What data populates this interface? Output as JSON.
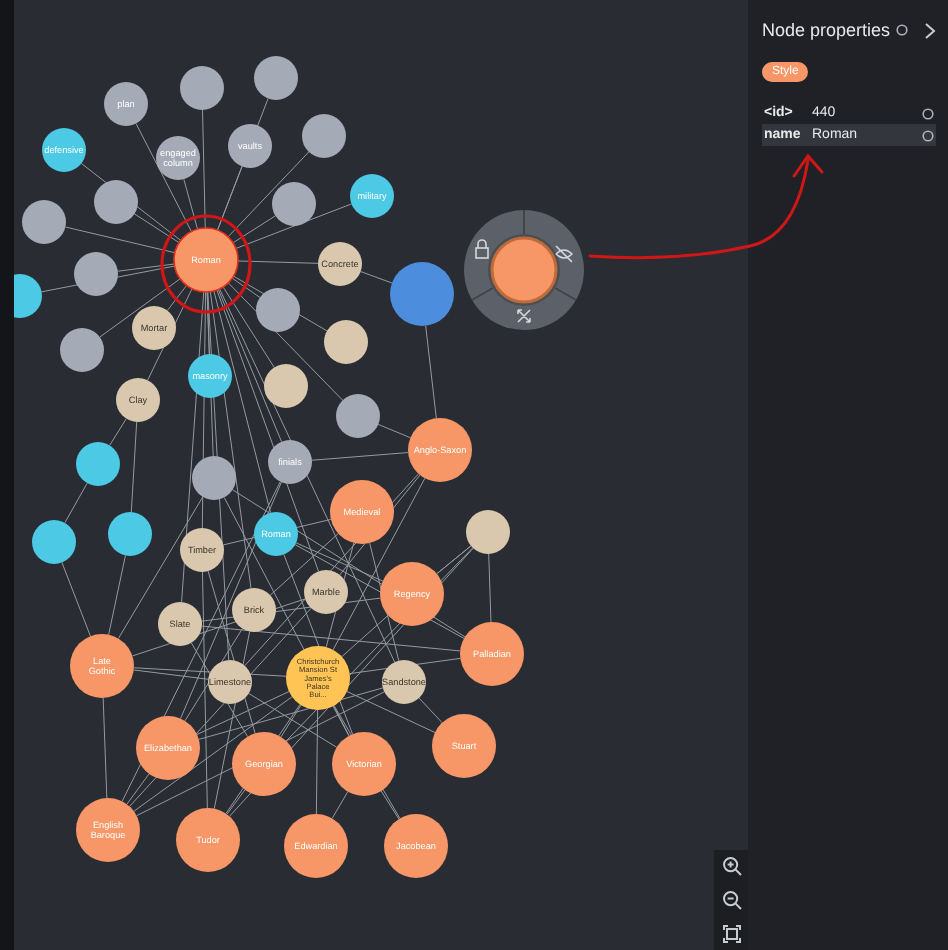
{
  "graph": {
    "nodes": [
      {
        "label": "Roman",
        "color": "#f79767",
        "kind": "big",
        "circled": true,
        "selected": false
      },
      {
        "label": "plan",
        "color": "#a5abb6",
        "kind": "small",
        "circled": false,
        "selected": false
      },
      {
        "color": "#a5abb6",
        "kind": "small",
        "circled": false,
        "selected": false
      },
      {
        "color": "#a5abb6",
        "kind": "small",
        "circled": false,
        "selected": false
      },
      {
        "label": "defensive",
        "color": "#4cc9e4",
        "kind": "small",
        "circled": false,
        "selected": false
      },
      {
        "label": "engaged column",
        "color": "#a5abb6",
        "kind": "small",
        "circled": false,
        "selected": false
      },
      {
        "label": "vaults",
        "color": "#a5abb6",
        "kind": "small",
        "circled": false,
        "selected": false
      },
      {
        "color": "#a5abb6",
        "kind": "small",
        "circled": false,
        "selected": false
      },
      {
        "color": "#a5abb6",
        "kind": "small",
        "circled": false,
        "selected": false
      },
      {
        "color": "#a5abb6",
        "kind": "small",
        "circled": false,
        "selected": false
      },
      {
        "label": "military",
        "color": "#4cc9e4",
        "kind": "small",
        "circled": false,
        "selected": false
      },
      {
        "color": "#a5abb6",
        "kind": "small",
        "circled": false,
        "selected": false
      },
      {
        "label": "Concrete",
        "color": "#d9c8ae",
        "kind": "small",
        "circled": false,
        "selected": false
      },
      {
        "color": "#4d8ddd",
        "kind": "big",
        "circled": false,
        "selected": false
      },
      {
        "color": "#a5abb6",
        "kind": "small",
        "circled": false,
        "selected": false
      },
      {
        "color": "#4cc9e4",
        "kind": "small",
        "circled": false,
        "selected": false
      },
      {
        "color": "#a5abb6",
        "kind": "small",
        "circled": false,
        "selected": false
      },
      {
        "label": "Mortar",
        "color": "#d9c8ae",
        "kind": "small",
        "circled": false,
        "selected": false
      },
      {
        "color": "#d9c8ae",
        "kind": "small",
        "circled": false,
        "selected": false
      },
      {
        "color": "#a5abb6",
        "kind": "small",
        "circled": false,
        "selected": false
      },
      {
        "label": "masonry",
        "color": "#4cc9e4",
        "kind": "small",
        "circled": false,
        "selected": false
      },
      {
        "color": "#d9c8ae",
        "kind": "small",
        "circled": false,
        "selected": false
      },
      {
        "label": "Clay",
        "color": "#d9c8ae",
        "kind": "small",
        "circled": false,
        "selected": false
      },
      {
        "color": "#a5abb6",
        "kind": "small",
        "circled": false,
        "selected": false
      },
      {
        "color": "#4cc9e4",
        "kind": "small",
        "circled": false,
        "selected": false
      },
      {
        "color": "#a5abb6",
        "kind": "small",
        "circled": false,
        "selected": false
      },
      {
        "label": "finials",
        "color": "#a5abb6",
        "kind": "small",
        "circled": false,
        "selected": false
      },
      {
        "label": "Anglo-Saxon",
        "color": "#f79767",
        "kind": "big",
        "circled": false,
        "selected": false
      },
      {
        "color": "#4cc9e4",
        "kind": "small",
        "circled": false,
        "selected": false
      },
      {
        "color": "#4cc9e4",
        "kind": "small",
        "circled": false,
        "selected": false
      },
      {
        "label": "Timber",
        "color": "#d9c8ae",
        "kind": "small",
        "circled": false,
        "selected": false
      },
      {
        "label": "Roman",
        "color": "#4cc9e4",
        "kind": "small",
        "circled": false,
        "selected": false
      },
      {
        "label": "Medieval",
        "color": "#f79767",
        "kind": "big",
        "circled": false,
        "selected": false
      },
      {
        "color": "#d9c8ae",
        "kind": "small",
        "circled": false,
        "selected": false
      },
      {
        "label": "Marble",
        "color": "#d9c8ae",
        "kind": "small",
        "circled": false,
        "selected": false
      },
      {
        "label": "Brick",
        "color": "#d9c8ae",
        "kind": "small",
        "circled": false,
        "selected": false
      },
      {
        "label": "Regency",
        "color": "#f79767",
        "kind": "big",
        "circled": false,
        "selected": false
      },
      {
        "label": "Slate",
        "color": "#d9c8ae",
        "kind": "small",
        "circled": false,
        "selected": false
      },
      {
        "label": "Late Gothic",
        "color": "#f79767",
        "kind": "big",
        "circled": false,
        "selected": false
      },
      {
        "label": "Palladian",
        "color": "#f79767",
        "kind": "big",
        "circled": false,
        "selected": false
      },
      {
        "label": "Limestone",
        "color": "#d9c8ae",
        "kind": "small",
        "circled": false,
        "selected": false
      },
      {
        "label": "Christchurch Mansion St James's Palace Bui...",
        "color": "#ffc454",
        "kind": "big",
        "circled": false,
        "selected": false
      },
      {
        "label": "Sandstone",
        "color": "#d9c8ae",
        "kind": "small",
        "circled": false,
        "selected": false
      },
      {
        "label": "Elizabethan",
        "color": "#f79767",
        "kind": "big",
        "circled": false,
        "selected": false
      },
      {
        "label": "Georgian",
        "color": "#f79767",
        "kind": "big",
        "circled": false,
        "selected": false
      },
      {
        "label": "Victorian",
        "color": "#f79767",
        "kind": "big",
        "circled": false,
        "selected": false
      },
      {
        "label": "Stuart",
        "color": "#f79767",
        "kind": "big",
        "circled": false,
        "selected": false
      },
      {
        "label": "English Baroque",
        "color": "#f79767",
        "kind": "big",
        "circled": false,
        "selected": false
      },
      {
        "label": "Tudor",
        "color": "#f79767",
        "kind": "big",
        "circled": false,
        "selected": false
      },
      {
        "label": "Edwardian",
        "color": "#f79767",
        "kind": "big",
        "circled": false,
        "selected": false
      },
      {
        "label": "Jacobean",
        "color": "#f79767",
        "kind": "big",
        "circled": false,
        "selected": false
      },
      {
        "color": "#f79767",
        "kind": "big",
        "circled": false,
        "selected": true
      }
    ]
  },
  "panel": {
    "title": "Node properties",
    "style_button": "Style",
    "properties": [
      {
        "key": "<id>",
        "value": "440",
        "selected": false
      },
      {
        "key": "name",
        "value": "Roman",
        "selected": true
      }
    ]
  }
}
